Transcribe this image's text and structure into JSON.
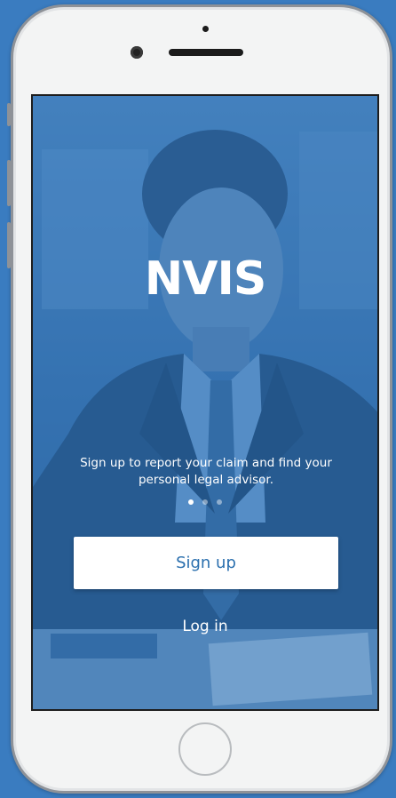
{
  "theme": {
    "background": "#3a7cc0",
    "overlay": "rgba(40,110,180,0.45)",
    "accent": "#2a6fae"
  },
  "app": {
    "logo_text": "NVIS",
    "tagline": "Sign up to report your claim and find your personal legal advisor.",
    "carousel": {
      "count": 3,
      "active_index": 0
    },
    "signup_label": "Sign up",
    "login_label": "Log in"
  },
  "icons": {
    "home": "home-button-icon",
    "camera": "front-camera-icon",
    "speaker": "earpiece-speaker-icon"
  }
}
